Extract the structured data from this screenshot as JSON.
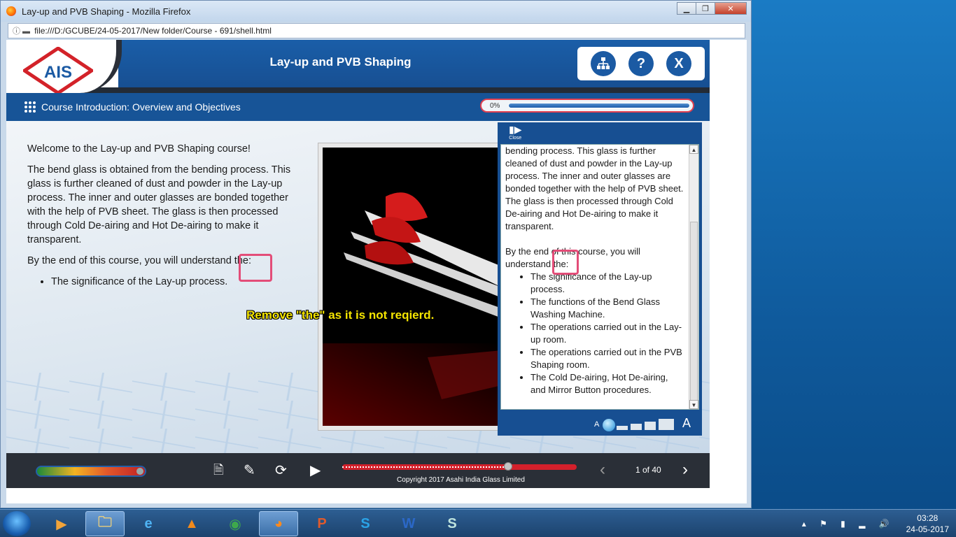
{
  "browser": {
    "title": "Lay-up and PVB Shaping - Mozilla Firefox",
    "url": "file:///D:/GCUBE/24-05-2017/New folder/Course - 691/shell.html"
  },
  "header": {
    "logo_text": "AIS",
    "course_title": "Lay-up and PVB Shaping",
    "help_label": "?",
    "close_label": "X"
  },
  "subbar": {
    "topic": "Course Introduction: Overview and Objectives",
    "progress_label": "0%",
    "progress_value": 0
  },
  "content": {
    "welcome": "Welcome to the Lay-up and PVB Shaping course!",
    "paragraph": "The bend glass is obtained from the bending process. This glass is further cleaned of dust and powder in the Lay-up process. The inner and outer glasses are bonded together with the help of PVB sheet. The glass is then processed through Cold De-airing and Hot De-airing to make it transparent.",
    "objectives_intro": "By the end of this course, you will understand the:",
    "bullets": [
      "The significance of the Lay-up process."
    ],
    "annotation": "Remove \"the\" as it is not reqierd."
  },
  "transcript": {
    "close_label": "Close",
    "text_top": "bending process. This glass is further cleaned of dust and powder in the Lay-up process. The inner and outer glasses are bonded together with the help of PVB sheet. The glass is then processed through Cold De-airing and Hot De-airing to make it transparent.",
    "objectives_intro": "By the end of this course, you will understand the:",
    "bullets": [
      "The significance of the Lay-up process.",
      "The functions of the Bend Glass Washing Machine.",
      "The operations carried out in the Lay-up room.",
      "The operations carried out in the PVB Shaping room.",
      "The Cold De-airing, Hot De-airing, and Mirror Button procedures."
    ],
    "font_small": "A",
    "font_large": "A"
  },
  "controls": {
    "copyright": "Copyright 2017 Asahi India Glass Limited",
    "page_count": "1 of 40",
    "seek_fraction": 0.7
  },
  "taskbar": {
    "time": "03:28",
    "date": "24-05-2017"
  }
}
